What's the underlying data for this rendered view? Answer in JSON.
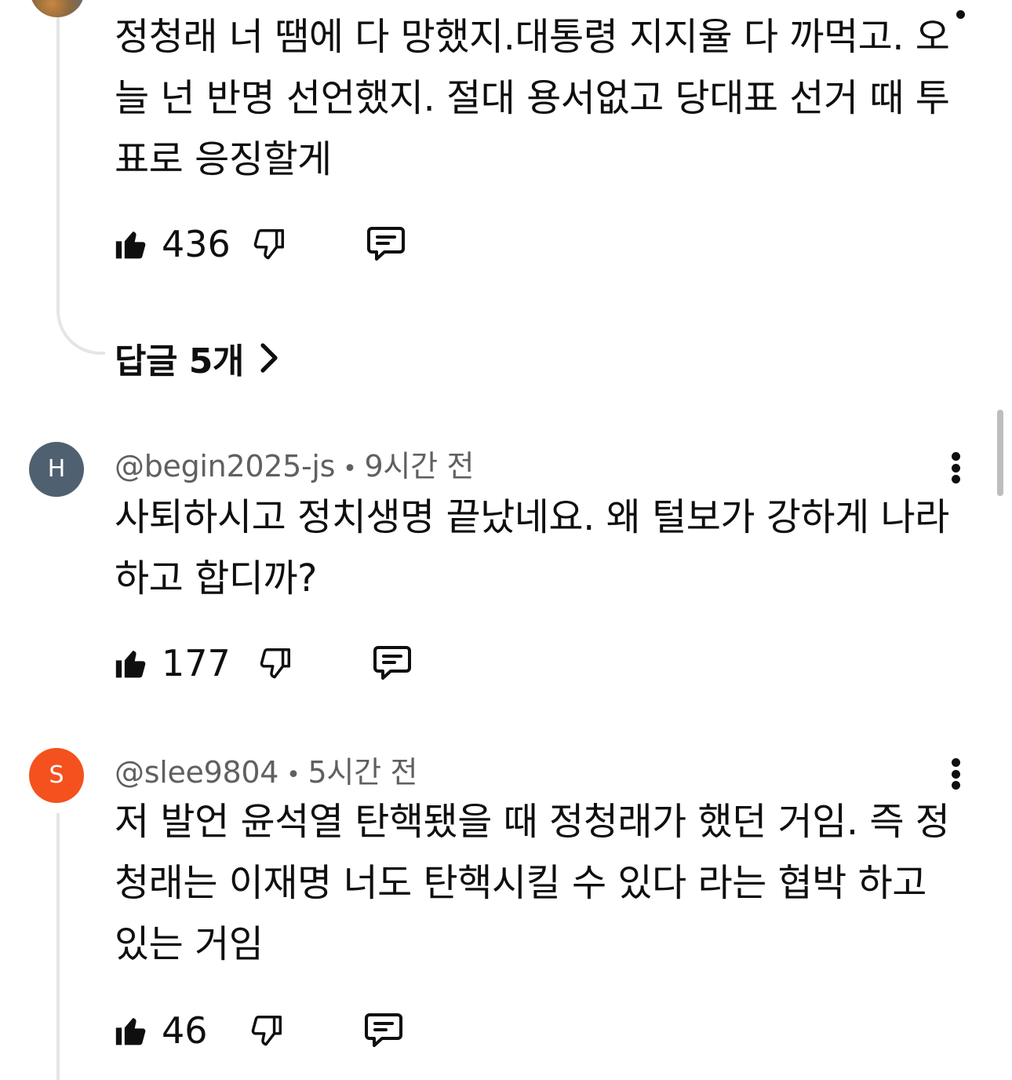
{
  "comments": [
    {
      "text": "정청래 너 땜에 다 망했지.대통령 지지율 다 까먹고. 오늘 넌 반명 선언했지. 절대 용서없고 당대표 선거 때 투표로 응징할게",
      "likes": "436",
      "replies_label": "답글 5개"
    },
    {
      "avatar_letter": "H",
      "avatar_color": "#4f6170",
      "handle": "@begin2025-js",
      "separator": "•",
      "time": "9시간 전",
      "text": "사퇴하시고 정치생명 끝났네요. 왜 털보가 강하게 나라하고 합디까?",
      "likes": "177"
    },
    {
      "avatar_letter": "S",
      "avatar_color": "#f4511e",
      "handle": "@slee9804",
      "separator": "•",
      "time": "5시간 전",
      "text": "저 발언 윤석열 탄핵됐을 때 정청래가 했던 거임. 즉 정청래는 이재명 너도 탄핵시킬 수 있다 라는 협박 하고 있는 거임",
      "likes": "46"
    }
  ]
}
